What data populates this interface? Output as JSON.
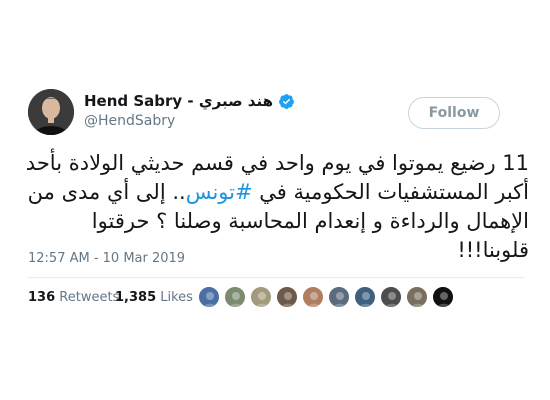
{
  "tweet": {
    "display_name": "Hend Sabry - هند صبري",
    "screen_name": "@HendSabry",
    "verified": true,
    "follow_label": "Follow",
    "text_part1": "11 رضيع يموتوا في يوم واحد في قسم حديثي الولادة بأحد أكبر المستشفيات الحكومية في ",
    "hashtag": "#تونس",
    "text_part2": ".. إلى أي مدى من الإهمال والرداءة و إنعدام المحاسبة وصلنا ؟ حرقتوا قلوبنا!!!",
    "timestamp": "12:57 AM - 10 Mar 2019",
    "retweets_count": "136",
    "retweets_label": "Retweets",
    "likes_count": "1,385",
    "likes_label": "Likes"
  },
  "colors": {
    "link_blue": "#1b95e0",
    "verified_blue": "#1da1f2",
    "secondary_text": "#657786",
    "primary_text": "#14171a"
  },
  "likers": [
    {
      "name": "liker-avatar-1",
      "color": "#4a6fa5"
    },
    {
      "name": "liker-avatar-2",
      "color": "#7b8b6f"
    },
    {
      "name": "liker-avatar-3",
      "color": "#a39a7c"
    },
    {
      "name": "liker-avatar-4",
      "color": "#6e5a4a"
    },
    {
      "name": "liker-avatar-5",
      "color": "#b07d62"
    },
    {
      "name": "liker-avatar-6",
      "color": "#5a6b7d"
    },
    {
      "name": "liker-avatar-7",
      "color": "#3f5f7f"
    },
    {
      "name": "liker-avatar-8",
      "color": "#4d4d4d"
    },
    {
      "name": "liker-avatar-9",
      "color": "#7a6f5e"
    },
    {
      "name": "liker-avatar-10",
      "color": "#111111"
    }
  ]
}
